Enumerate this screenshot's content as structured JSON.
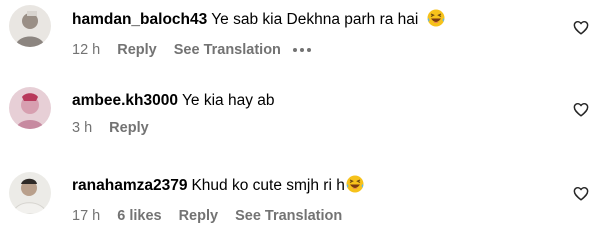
{
  "comments": [
    {
      "username": "hamdan_baloch43",
      "text": "Ye sab kia Dekhna parh ra hai",
      "emoji": "laughing-face-icon",
      "time": "12 h",
      "reply_label": "Reply",
      "see_translation_label": "See Translation",
      "has_more_options": true
    },
    {
      "username": "ambee.kh3000",
      "text": "Ye kia hay ab",
      "time": "3 h",
      "reply_label": "Reply"
    },
    {
      "username": "ranahamza2379",
      "text": "Khud ko cute smjh ri h",
      "emoji": "laughing-face-icon",
      "time": "17 h",
      "likes": "6 likes",
      "reply_label": "Reply",
      "see_translation_label": "See Translation"
    }
  ],
  "colors": {
    "text": "#000000",
    "secondary": "#737373",
    "background": "#ffffff"
  }
}
